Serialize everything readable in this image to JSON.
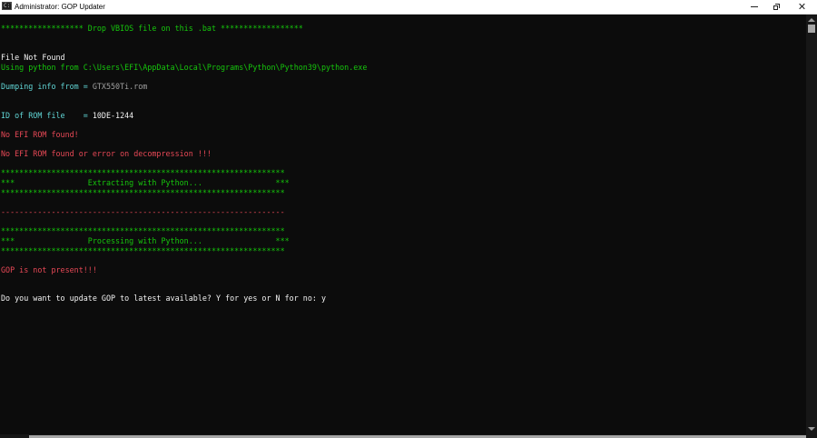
{
  "window": {
    "title": "Administrator:  GOP Updater",
    "icon": "console-icon",
    "icon_glyph": "C:\\",
    "controls": {
      "minimize_icon": "minimize-icon",
      "maximize_icon": "restore-icon",
      "close_icon": "close-icon",
      "close_glyph": "✕"
    }
  },
  "colors": {
    "background": "#0c0c0c",
    "green": "#16c60c",
    "white": "#f2f2f2",
    "cyan": "#61d6d6",
    "red": "#e74856",
    "gray": "#a0a0a0"
  },
  "console": {
    "header_banner": "****************** Drop VBIOS file on this .bat ******************",
    "file_not_found": "File Not Found",
    "python_path": "Using python from C:\\Users\\EFI\\AppData\\Local\\Programs\\Python\\Python39\\python.exe",
    "dumping_label": "Dumping info from = ",
    "dumping_file": "GTX550Ti.rom",
    "rom_id_label": "ID of ROM file    = ",
    "rom_id_value": "10DE-1244",
    "no_efi_rom": "No EFI ROM found!",
    "no_efi_rom_error": "No EFI ROM found or error on decompression !!!",
    "stars_line": "**************************************************************",
    "extracting_line": "***                Extracting with Python...                ***",
    "dashes_line": "--------------------------------------------------------------",
    "processing_line": "***                Processing with Python...                ***",
    "gop_not_present": "GOP is not present!!!",
    "update_prompt": "Do you want to update GOP to latest available? Y for yes or N for no: y"
  }
}
